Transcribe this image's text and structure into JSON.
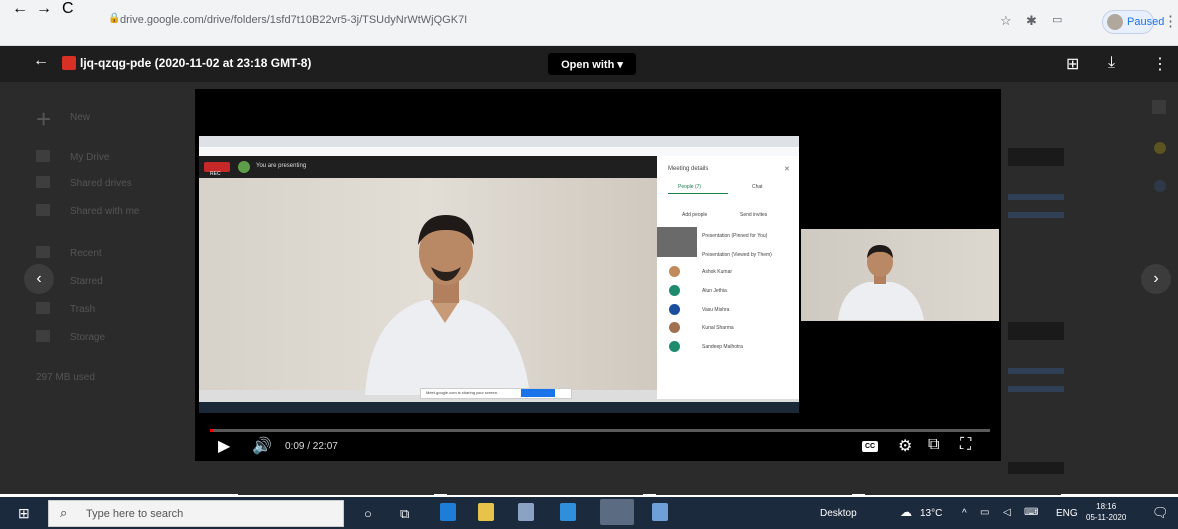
{
  "browser": {
    "back": "←",
    "forward": "→",
    "reload": "C",
    "url": "drive.google.com/drive/folders/1sfd7t10B22vr5-3j/TSUdyNrWtWjQGK7I",
    "profile_label": "Paused",
    "menu": "⋮"
  },
  "viewer": {
    "file_name": "ljq-qzqg-pde (2020-11-02 at 23:18 GMT-8)",
    "open_with": "Open with ▾",
    "back_icon": "←"
  },
  "drive_bg": {
    "new": "New",
    "items": [
      "My Drive",
      "Shared drives",
      "Shared with me",
      "Recent",
      "Starred",
      "Trash",
      "Storage"
    ],
    "storage": "297 MB used"
  },
  "meeting": {
    "rec_label": "REC",
    "presenting": "You are presenting",
    "panel_title": "Meeting details",
    "panel_tabs": [
      "People (7)",
      "Chat"
    ],
    "panel_actions": [
      "Add people",
      "Send invites"
    ],
    "participants": [
      "Presentation (Pinned for You)",
      "Presentation (Viewed by Them)",
      "Ashok Kumar",
      "Alun Jethia",
      "Vasu Mishra",
      "Kunal Sharma",
      "Sandeep Malhotra"
    ],
    "share_bar": "Meet.google.com is sharing your screen."
  },
  "player": {
    "time": "0:09 / 22:07",
    "cc": "CC",
    "progress_fraction": 0.004
  },
  "taskbar": {
    "search_placeholder": "Type here to search",
    "tray_text": "Desktop",
    "weather": "13°C",
    "lang": "ENG",
    "time": "18:16",
    "date": "05-11-2020"
  },
  "colors": {
    "accent": "#1a73e8",
    "rec": "#c62828",
    "progress": "#ff0000",
    "taskbar": "#1c2a3e"
  }
}
